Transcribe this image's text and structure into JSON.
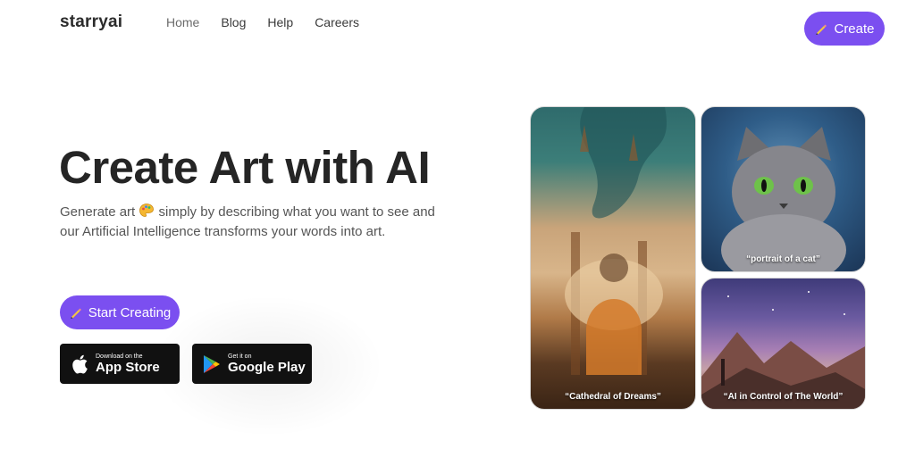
{
  "brand": {
    "logo": "starryai"
  },
  "nav": {
    "items": [
      "Home",
      "Blog",
      "Help",
      "Careers"
    ]
  },
  "header": {
    "create_label": "Create"
  },
  "hero": {
    "title": "Create Art with AI",
    "desc_part1": "Generate art ",
    "desc_part2": " simply by describing what you want to see and our Artificial Intelligence transforms your words into art.",
    "start_label": "Start Creating"
  },
  "stores": {
    "apple": {
      "small": "Download on the",
      "big": "App Store"
    },
    "google": {
      "small": "Get it on",
      "big": "Google Play"
    }
  },
  "gallery": {
    "cathedral_caption": "“Cathedral of Dreams”",
    "cat_caption": "“portrait of a cat”",
    "world_caption": "“AI in Control of The World”"
  },
  "colors": {
    "accent": "#7b4ff0",
    "store_bg": "#111111"
  },
  "icons": {
    "create": "pencil-icon",
    "palette": "palette-icon",
    "apple": "apple-icon",
    "google": "google-play-icon"
  }
}
